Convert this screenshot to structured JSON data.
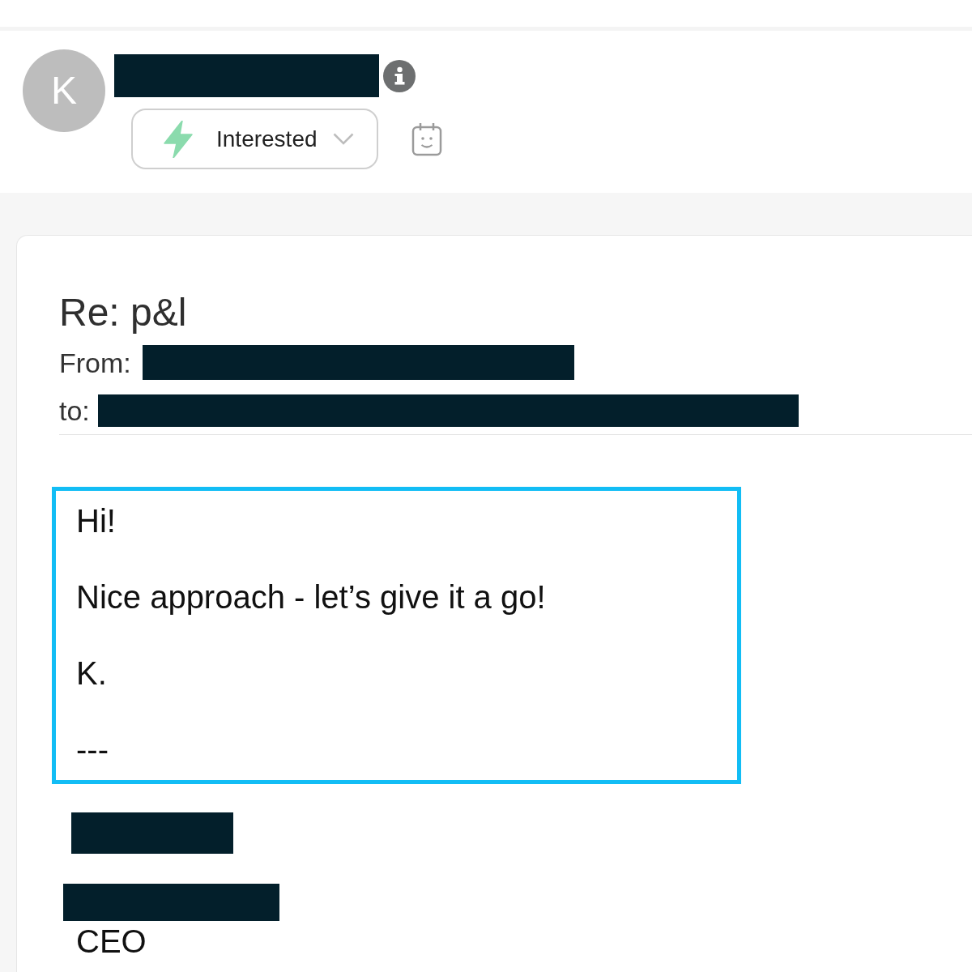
{
  "contact": {
    "initial": "K",
    "name_redacted": true,
    "status": {
      "label": "Interested"
    }
  },
  "message": {
    "subject": "Re: p&l",
    "from": {
      "label": "From:",
      "redacted": true
    },
    "to": {
      "label": "to:",
      "redacted": true
    },
    "body": {
      "highlighted": true,
      "paragraphs": [
        "Hi!",
        "Nice approach - let’s give it a go!",
        "K.",
        "---"
      ]
    },
    "signature": [
      {
        "kind": "redacted"
      },
      {
        "kind": "redacted"
      },
      {
        "kind": "text",
        "text": "CEO"
      }
    ]
  }
}
